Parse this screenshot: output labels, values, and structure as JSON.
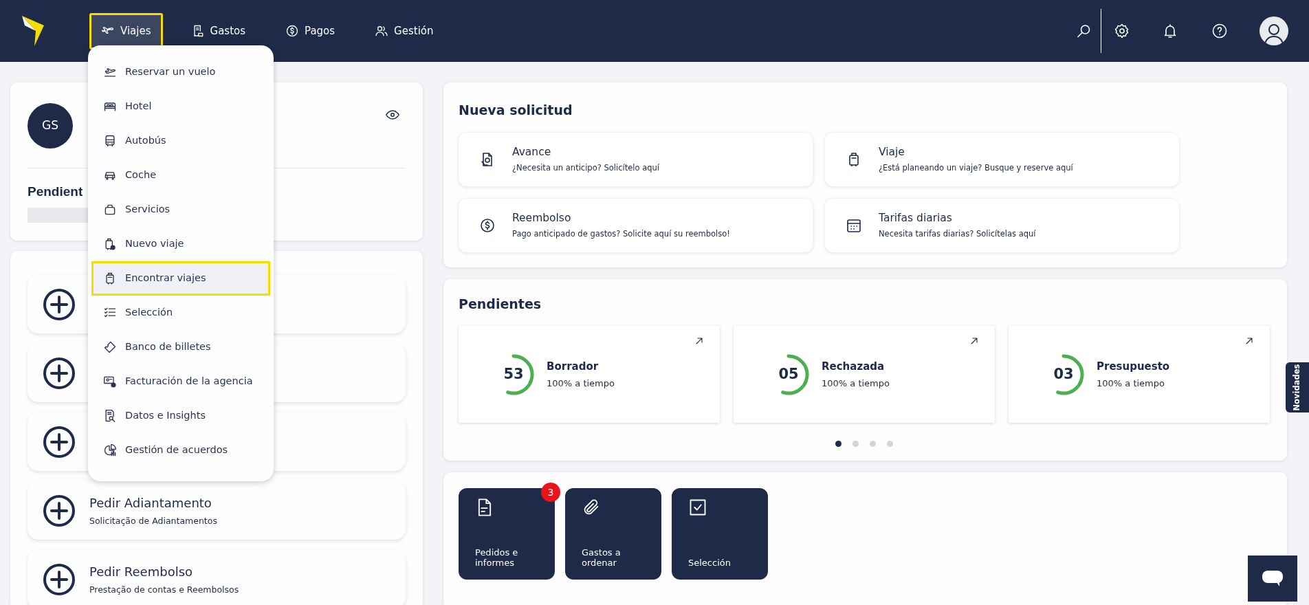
{
  "nav": {
    "items": [
      {
        "label": "Viajes",
        "selected": true
      },
      {
        "label": "Gastos",
        "selected": false
      },
      {
        "label": "Pagos",
        "selected": false
      },
      {
        "label": "Gestión",
        "selected": false
      }
    ]
  },
  "menu": {
    "items": [
      {
        "label": "Reservar un vuelo",
        "selected": false
      },
      {
        "label": "Hotel",
        "selected": false
      },
      {
        "label": "Autobús",
        "selected": false
      },
      {
        "label": "Coche",
        "selected": false
      },
      {
        "label": "Servicios",
        "selected": false
      },
      {
        "label": "Nuevo viaje",
        "selected": false
      },
      {
        "label": "Encontrar viajes",
        "selected": true
      },
      {
        "label": "Selección",
        "selected": false
      },
      {
        "label": "Banco de billetes",
        "selected": false
      },
      {
        "label": "Facturación de la agencia",
        "selected": false
      },
      {
        "label": "Datos e Insights",
        "selected": false
      },
      {
        "label": "Gestión de acuerdos",
        "selected": false
      }
    ]
  },
  "profile": {
    "initials": "GS",
    "section_title": "Pendient"
  },
  "actions": [
    {
      "kind": "covered"
    },
    {
      "kind": "covered"
    },
    {
      "kind": "covered"
    },
    {
      "kind": "text",
      "title": "Pedir Adiantamento",
      "subtitle": "Solicitação de Adiantamentos"
    },
    {
      "kind": "text",
      "title": "Pedir Reembolso",
      "subtitle": "Prestação de contas e Reembolsos"
    }
  ],
  "new_request": {
    "title": "Nueva solicitud",
    "tiles": [
      {
        "title": "Avance",
        "subtitle": "¿Necesita un anticipo? Solicítelo aquí"
      },
      {
        "title": "Viaje",
        "subtitle": "¿Está planeando un viaje? Busque y reserve aquí"
      },
      {
        "title": "Reembolso",
        "subtitle": "Pago anticipado de gastos? Solicite aquí su reembolso!"
      },
      {
        "title": "Tarifas diarias",
        "subtitle": "Necesita tarifas diarias? Solicítelas aquí"
      }
    ]
  },
  "pending": {
    "title": "Pendientes",
    "stats": [
      {
        "value": "53",
        "label": "Borrador",
        "note": "100% a tiempo",
        "level": 0.55
      },
      {
        "value": "05",
        "label": "Rechazada",
        "note": "100% a tiempo",
        "level": 0.55
      },
      {
        "value": "03",
        "label": "Presupuesto",
        "note": "100% a tiempo",
        "level": 0.55
      }
    ],
    "pages": [
      {
        "selected": true
      },
      {
        "selected": false
      },
      {
        "selected": false
      },
      {
        "selected": false
      }
    ]
  },
  "shortcuts": [
    {
      "label": "Pedidos e informes",
      "badge": "3"
    },
    {
      "label": "Gastos a ordenar"
    },
    {
      "label": "Selección"
    }
  ],
  "side_tab": {
    "label": "Novidades"
  }
}
